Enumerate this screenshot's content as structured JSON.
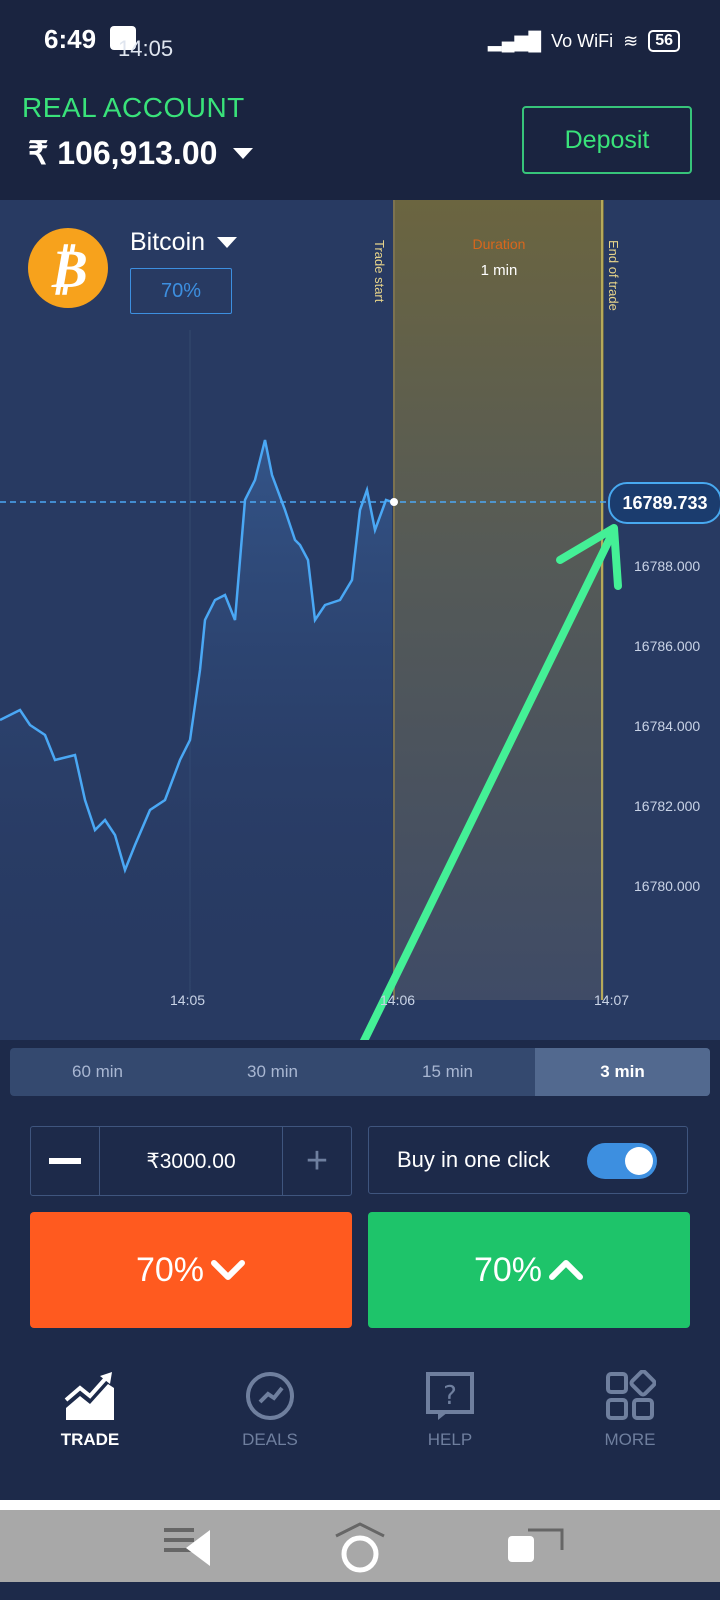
{
  "status_bar": {
    "time": "6:49",
    "secondary_time": "14:05",
    "carrier": "Vo WiFi",
    "battery": "56"
  },
  "account": {
    "type_label": "REAL ACCOUNT",
    "balance": "₹ 106,913.00",
    "deposit_label": "Deposit"
  },
  "asset": {
    "name": "Bitcoin",
    "payout": "70%",
    "icon": "bitcoin-icon"
  },
  "chart": {
    "trade_start_label": "Trade start",
    "end_of_trade_label": "End of trade",
    "duration_label": "Duration",
    "duration_value": "1 min",
    "current_price": "16789.733",
    "y_ticks": [
      "16788.000",
      "16786.000",
      "16784.000",
      "16782.000",
      "16780.000"
    ],
    "x_ticks": [
      "14:05",
      "14:06",
      "14:07"
    ]
  },
  "timeframes": [
    {
      "label": "60 min",
      "active": false
    },
    {
      "label": "30 min",
      "active": false
    },
    {
      "label": "15 min",
      "active": false
    },
    {
      "label": "3 min",
      "active": true
    }
  ],
  "trade": {
    "amount": "₹3000.00",
    "one_click_label": "Buy in one click",
    "one_click_on": true,
    "down_label": "70%",
    "up_label": "70%",
    "down_color": "#ff5a1f",
    "up_color": "#1ec46a"
  },
  "nav": [
    {
      "label": "TRADE",
      "icon": "trade-chart-icon",
      "active": true
    },
    {
      "label": "DEALS",
      "icon": "deals-icon",
      "active": false
    },
    {
      "label": "HELP",
      "icon": "help-icon",
      "active": false
    },
    {
      "label": "MORE",
      "icon": "more-grid-icon",
      "active": false
    }
  ],
  "colors": {
    "accent_green": "#39e27a",
    "accent_blue": "#3d8fe0",
    "background": "#1d2a4a"
  }
}
